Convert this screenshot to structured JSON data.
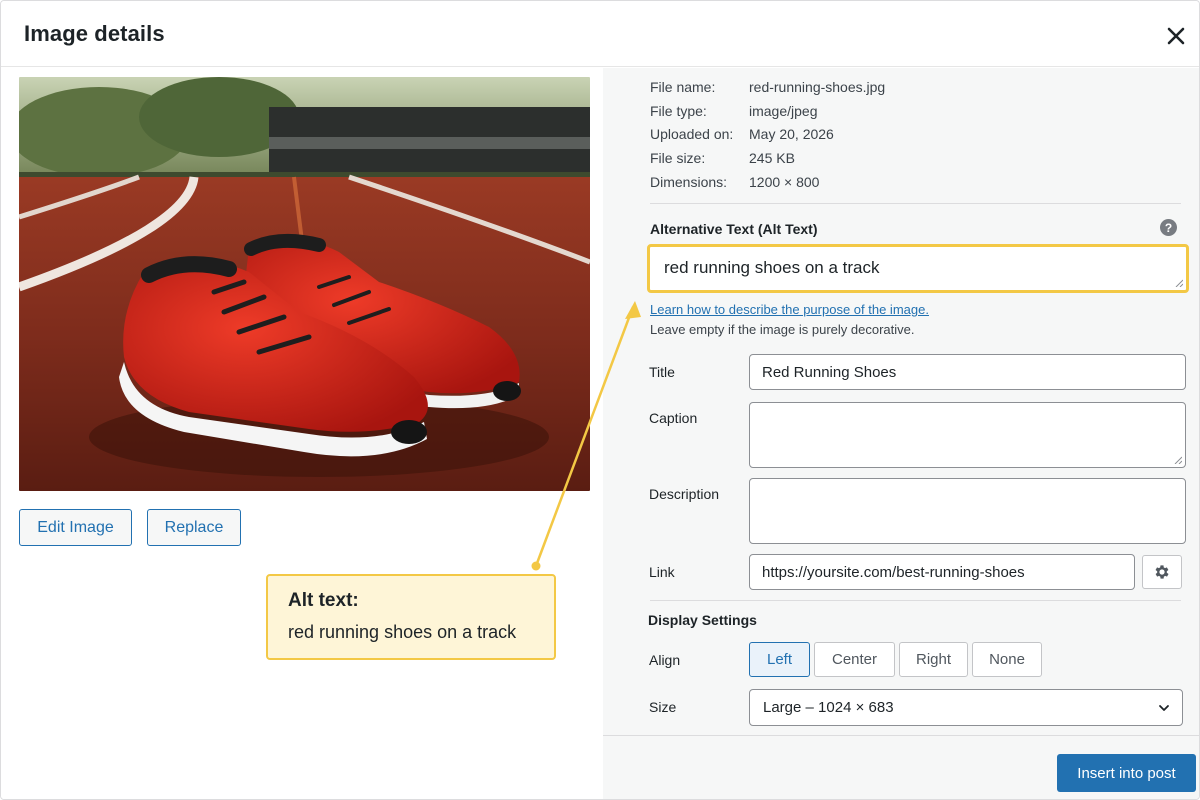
{
  "window": {
    "title": "Image details"
  },
  "preview": {
    "edit_label": "Edit Image",
    "replace_label": "Replace"
  },
  "callout": {
    "heading": "Alt text:",
    "text": "red running shoes on a track"
  },
  "meta": [
    {
      "label": "File name:",
      "value": "red-running-shoes.jpg"
    },
    {
      "label": "File type:",
      "value": "image/jpeg"
    },
    {
      "label": "Uploaded on:",
      "value": "May 20, 2026"
    },
    {
      "label": "File size:",
      "value": "245 KB"
    },
    {
      "label": "Dimensions:",
      "value": "1200 × 800"
    }
  ],
  "alt": {
    "label": "Alternative Text (Alt Text)",
    "value": "red running shoes on a track",
    "learn_link": "Learn how to describe the purpose of the image.",
    "hint": "Leave empty if the image is purely decorative."
  },
  "fields": {
    "title_label": "Title",
    "title_value": "Red Running Shoes",
    "caption_label": "Caption",
    "caption_value": "",
    "description_label": "Description",
    "description_value": "",
    "link_label": "Link",
    "link_value": "https://yoursite.com/best-running-shoes"
  },
  "display": {
    "section_title": "Display Settings",
    "align_label": "Align",
    "align_options": [
      "Left",
      "Center",
      "Right",
      "None"
    ],
    "align_selected": "Left",
    "size_label": "Size",
    "size_value": "Large – 1024 × 683"
  },
  "footer": {
    "insert_label": "Insert into post"
  },
  "colors": {
    "accent": "#2271b1",
    "highlight": "#f3c845",
    "callout_bg": "#fef5d7"
  },
  "icons": {
    "close": "close-icon",
    "help": "help-icon",
    "gear": "gear-icon",
    "chevron": "chevron-down-icon"
  }
}
